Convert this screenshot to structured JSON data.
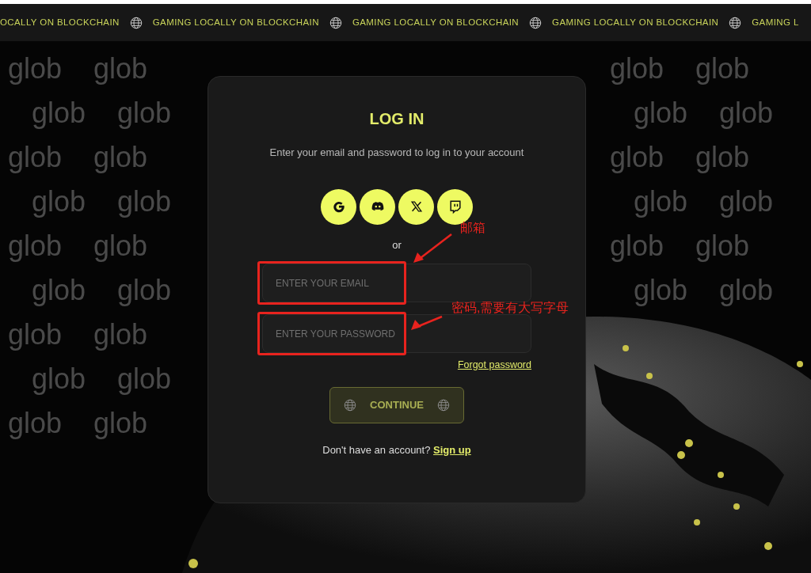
{
  "ticker": {
    "items": [
      {
        "text": "OCALLY ON BLOCKCHAIN"
      },
      {
        "text": "GAMING LOCALLY ON BLOCKCHAIN"
      },
      {
        "text": "GAMING LOCALLY ON BLOCKCHAIN"
      },
      {
        "text": "GAMING LOCALLY ON BLOCKCHAIN"
      },
      {
        "text": "GAMING L"
      }
    ]
  },
  "background_pattern": {
    "rows": [
      {
        "left": "glob glob",
        "right": "glob glob"
      },
      {
        "left": "glob glob",
        "right": "glob glob"
      },
      {
        "left": "glob glob",
        "right": "glob glob"
      },
      {
        "left": "glob glob",
        "right": "glob glob"
      },
      {
        "left": "glob glob",
        "right": "glob glob"
      },
      {
        "left": "glob glob",
        "right": "glob glob"
      },
      {
        "left": "glob glob"
      },
      {
        "left": "glob glob"
      },
      {
        "left": "glob glob"
      }
    ]
  },
  "login_card": {
    "title": "LOG IN",
    "subtitle": "Enter your email and password to log in to your account",
    "social_buttons": [
      {
        "kind": "google"
      },
      {
        "kind": "discord"
      },
      {
        "kind": "x"
      },
      {
        "kind": "twitch"
      }
    ],
    "divider_text": "or",
    "fields": [
      {
        "placeholder": "ENTER YOUR EMAIL"
      },
      {
        "placeholder": "ENTER YOUR PASSWORD"
      }
    ],
    "forgot_link": "Forgot password",
    "continue_button": {
      "label": "CONTINUE",
      "disabled": true
    },
    "signup_prompt": "Don't have an account?",
    "signup_link": "Sign up"
  },
  "annotations": [
    {
      "label": "邮箱"
    },
    {
      "label": "密码,需要有大写字母"
    }
  ]
}
